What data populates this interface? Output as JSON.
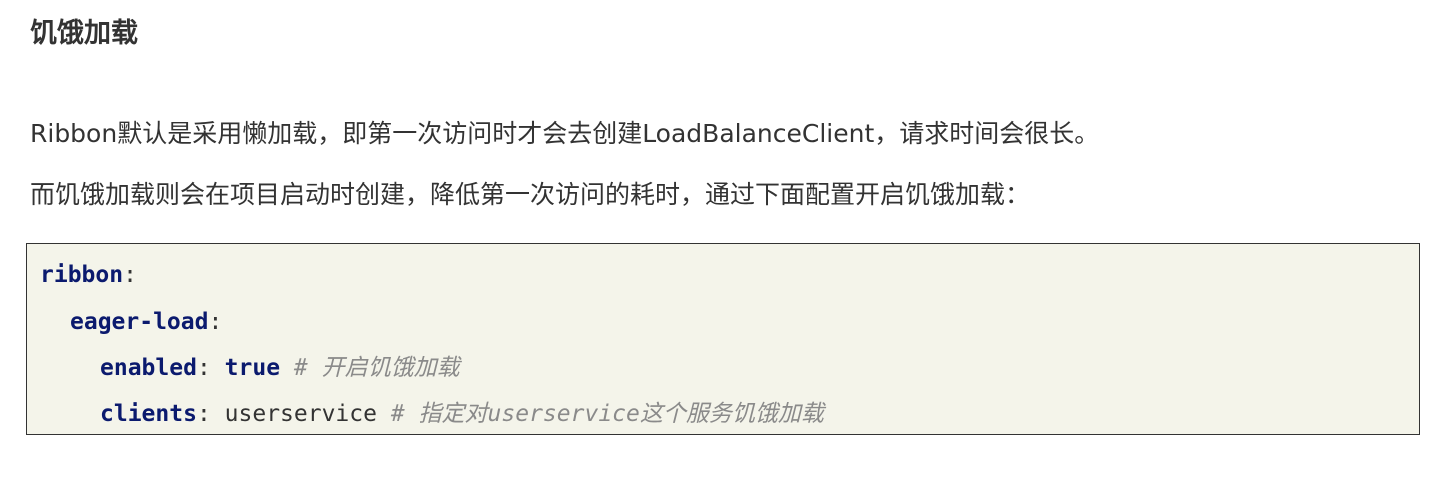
{
  "heading": "饥饿加载",
  "paragraphs": [
    "Ribbon默认是采用懒加载，即第一次访问时才会去创建LoadBalanceClient，请求时间会很长。",
    "而饥饿加载则会在项目启动时创建，降低第一次访问的耗时，通过下面配置开启饥饿加载："
  ],
  "code": {
    "line1": {
      "key": "ribbon",
      "colon": ":"
    },
    "line2": {
      "key": "eager-load",
      "colon": ":"
    },
    "line3": {
      "key": "enabled",
      "colon": ":",
      "value": "true",
      "comment": "# 开启饥饿加载"
    },
    "line4": {
      "key": "clients",
      "colon": ":",
      "value": "userservice",
      "comment": "# 指定对userservice这个服务饥饿加载"
    }
  },
  "colors": {
    "key": "#0b1a6e",
    "comment": "#8a8a8a",
    "code_background": "#f4f4ea",
    "text": "#333333"
  }
}
